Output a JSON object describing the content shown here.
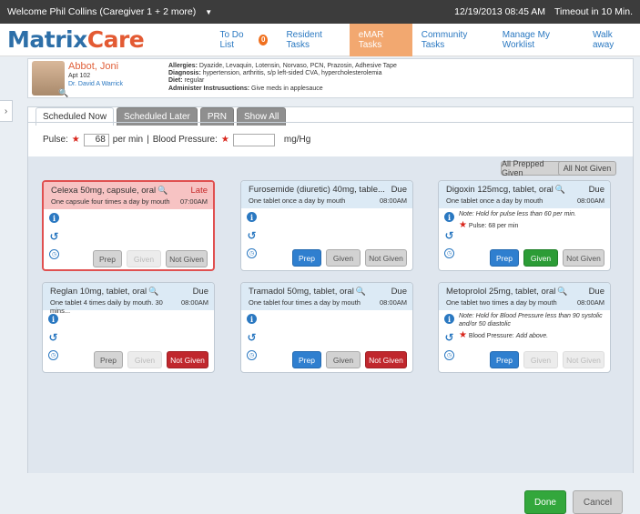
{
  "topbar": {
    "welcome": "Welcome Phil Collins (Caregiver 1 + 2 more)",
    "datetime": "12/19/2013 08:45 AM",
    "timeout": "Timeout in 10 Min."
  },
  "logo": {
    "matrix": "Matrix",
    "care": "Care"
  },
  "nav": {
    "todo": "To Do List",
    "todo_count": "0",
    "resident_tasks": "Resident Tasks",
    "emar_tasks": "eMAR Tasks",
    "community_tasks": "Community Tasks",
    "manage_worklist": "Manage My Worklist",
    "walk_away": "Walk away"
  },
  "resident": {
    "name": "Abbot, Joni",
    "apt": "Apt 102",
    "doctor": "Dr. David A Warrick",
    "allergies_label": "Allergies:",
    "allergies": "Dyazide, Levaquin, Lotensin, Norvaso, PCN, Prazosin, Adhesive Tape",
    "diagnosis_label": "Diagnosis:",
    "diagnosis": "hypertension, arthritis, s/p left-sided CVA, hypercholesterolemia",
    "diet_label": "Diet:",
    "diet": "regular",
    "admin_label": "Administer Instrusuctions:",
    "admin": "Give meds in applesauce"
  },
  "tabs": [
    "Scheduled Now",
    "Scheduled Later",
    "PRN",
    "Show All"
  ],
  "vitals": {
    "pulse_label": "Pulse:",
    "pulse_value": "68",
    "pulse_unit": "per min",
    "sep": "|",
    "bp_label": "Blood Pressure:",
    "bp_value": "",
    "bp_unit": "mg/Hg"
  },
  "actions": {
    "all_prepped": "All Prepped Given",
    "all_not_given": "All Not Given",
    "done": "Done",
    "cancel": "Cancel"
  },
  "meds": [
    {
      "title": "Celexa 50mg, capsule, oral",
      "status": "Late",
      "sig": "One capsule four times a day by mouth",
      "time": "07:00AM",
      "prep": "Prep",
      "given": "Given",
      "not_given": "Not Given"
    },
    {
      "title": "Furosemide (diuretic) 40mg, table...",
      "status": "Due",
      "sig": "One tablet once a day by mouth",
      "time": "08:00AM",
      "prep": "Prep",
      "given": "Given",
      "not_given": "Not Given"
    },
    {
      "title": "Digoxin 125mcg, tablet, oral",
      "status": "Due",
      "sig": "One tablet once a day by mouth",
      "time": "08:00AM",
      "note": "Note: Hold for pulse less than 60 per min.",
      "vital": "Pulse: 68 per min",
      "prep": "Prep",
      "given": "Given",
      "not_given": "Not Given"
    },
    {
      "title": "Reglan 10mg, tablet, oral",
      "status": "Due",
      "sig": "One tablet 4 times daily by mouth. 30 mins...",
      "time": "08:00AM",
      "prep": "Prep",
      "given": "Given",
      "not_given": "Not Given"
    },
    {
      "title": "Tramadol 50mg, tablet, oral",
      "status": "Due",
      "sig": "One tablet four times a day by mouth",
      "time": "08:00AM",
      "prep": "Prep",
      "given": "Given",
      "not_given": "Not Given"
    },
    {
      "title": "Metoprolol 25mg, tablet, oral",
      "status": "Due",
      "sig": "One tablet two times a day by mouth",
      "time": "08:00AM",
      "note": "Note: Hold for Blood Pressure less than 90 systolic and/or 50 diastolic",
      "vital_label": "Blood Pressure:",
      "vital_hint": "Add above.",
      "prep": "Prep",
      "given": "Given",
      "not_given": "Not Given"
    }
  ]
}
